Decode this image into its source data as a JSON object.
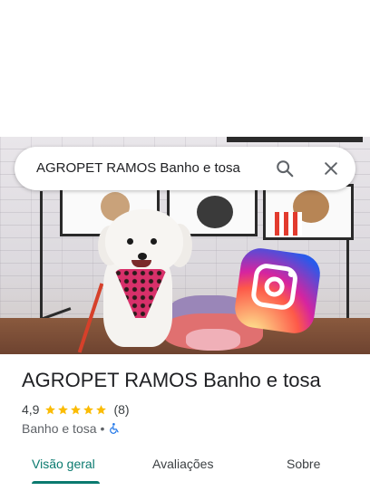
{
  "search": {
    "query": "AGROPET RAMOS Banho e tosa"
  },
  "place": {
    "name": "AGROPET RAMOS Banho e tosa",
    "rating": "4,9",
    "stars": 5,
    "reviews": "(8)",
    "category": "Banho e tosa",
    "separator": "•"
  },
  "tabs": [
    {
      "label": "Visão geral",
      "active": true
    },
    {
      "label": "Avaliações",
      "active": false
    },
    {
      "label": "Sobre",
      "active": false
    }
  ],
  "icons": {
    "search": "search-icon",
    "close": "close-icon",
    "star": "star-icon",
    "accessibility": "wheelchair-icon"
  },
  "colors": {
    "accent": "#0a7a6f",
    "star": "#fbbc04",
    "accessibility": "#1a73e8"
  }
}
